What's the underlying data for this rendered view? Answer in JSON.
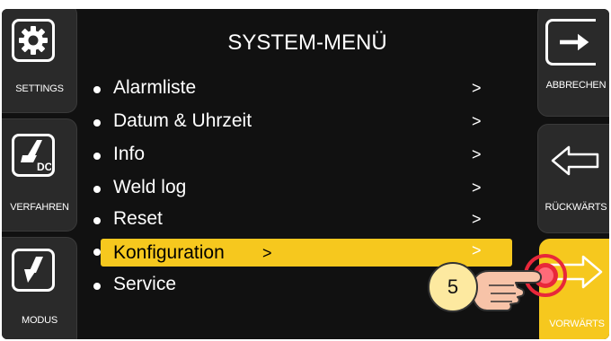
{
  "menu": {
    "title": "SYSTEM-MENÜ",
    "items": [
      {
        "label": "Alarmliste",
        "arrow": ">"
      },
      {
        "label": "Datum & Uhrzeit",
        "arrow": ">"
      },
      {
        "label": "Info",
        "arrow": ">"
      },
      {
        "label": "Weld log",
        "arrow": ">"
      },
      {
        "label": "Reset",
        "arrow": ">"
      },
      {
        "label": "Konfiguration",
        "arrow": ">"
      },
      {
        "label": "Service",
        "arrow": ""
      }
    ],
    "selected_index": 5,
    "selected_trailing_arrow": ">"
  },
  "left_buttons": [
    {
      "label": "SETTINGS",
      "icon": "gear-icon"
    },
    {
      "label": "VERFAHREN",
      "icon": "welding-torch-dc-icon",
      "icon_text": "DC"
    },
    {
      "label": "MODUS",
      "icon": "torch-trigger-icon"
    }
  ],
  "right_buttons": [
    {
      "label": "ABBRECHEN",
      "icon": "exit-arrow-icon"
    },
    {
      "label": "RÜCKWÄRTS",
      "icon": "arrow-left-icon"
    },
    {
      "label": "VORWÄRTS",
      "icon": "arrow-right-icon",
      "active": true
    }
  ],
  "callout": {
    "number": "5",
    "icon": "pointing-hand-icon"
  },
  "colors": {
    "screen": "#111111",
    "button": "#2a2a2a",
    "accent": "#f6c81e",
    "text": "#ffffff",
    "badge": "#fde9a0",
    "press": "#e8273a"
  }
}
